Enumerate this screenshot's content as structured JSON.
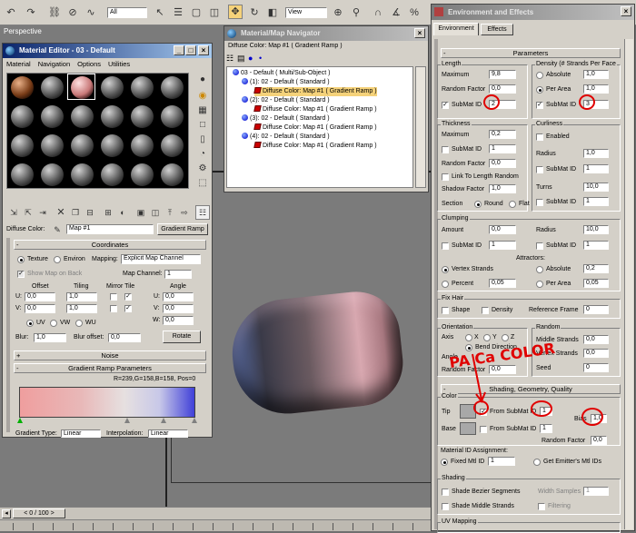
{
  "toolbar": {
    "selection_filter": "All",
    "view_dropdown": "View"
  },
  "viewport": {
    "label": "Perspective"
  },
  "material_editor": {
    "title": "Material Editor - 03 - Default",
    "menu": [
      "Material",
      "Navigation",
      "Options",
      "Utilities"
    ],
    "diffuse_color_label": "Diffuse Color:",
    "map_name": "Map #1",
    "map_type_button": "Gradient Ramp",
    "coordinates": {
      "title": "Coordinates",
      "texture_label": "Texture",
      "environ_label": "Environ",
      "mapping_label": "Mapping:",
      "mapping_value": "Explicit Map Channel",
      "show_map_on_back": "Show Map on Back",
      "map_channel_label": "Map Channel:",
      "map_channel_value": "1",
      "offset_header": "Offset",
      "tiling_header": "Tiling",
      "mirror_tile_header": "Mirror Tile",
      "angle_header": "Angle",
      "u_label": "U:",
      "v_label": "V:",
      "w_label": "W:",
      "u_offset": "0,0",
      "v_offset": "0,0",
      "u_tiling": "1,0",
      "v_tiling": "1,0",
      "u_angle": "0,0",
      "v_angle": "0,0",
      "w_angle": "0,0",
      "uv_label": "UV",
      "vw_label": "VW",
      "wu_label": "WU",
      "blur_label": "Blur:",
      "blur_value": "1,0",
      "blur_offset_label": "Blur offset:",
      "blur_offset_value": "0,0",
      "rotate_button": "Rotate"
    },
    "noise_title": "Noise",
    "gradient_ramp_title": "Gradient Ramp Parameters",
    "gradient_readout": "R=239,G=158,B=158, Pos=0",
    "gradient_type_label": "Gradient Type:",
    "gradient_type_value": "Linear",
    "interpolation_label": "Interpolation:",
    "interpolation_value": "Linear"
  },
  "navigator": {
    "title": "Material/Map Navigator",
    "header_text": "Diffuse Color: Map #1 ( Gradient Ramp )",
    "tree": [
      {
        "text": "03 - Default  ( Multi/Sub-Object )",
        "kind": "ball",
        "indent": 0,
        "selected": false
      },
      {
        "text": "(1): 02 - Default  ( Standard )",
        "kind": "ball",
        "indent": 1,
        "selected": false
      },
      {
        "text": "Diffuse Color: Map #1  ( Gradient Ramp )",
        "kind": "map",
        "indent": 2,
        "selected": true
      },
      {
        "text": "(2): 02 - Default  ( Standard )",
        "kind": "ball",
        "indent": 1,
        "selected": false
      },
      {
        "text": "Diffuse Color: Map #1  ( Gradient Ramp )",
        "kind": "map",
        "indent": 2,
        "selected": false
      },
      {
        "text": "(3): 02 - Default  ( Standard )",
        "kind": "ball",
        "indent": 1,
        "selected": false
      },
      {
        "text": "Diffuse Color: Map #1  ( Gradient Ramp )",
        "kind": "map",
        "indent": 2,
        "selected": false
      },
      {
        "text": "(4): 02 - Default  ( Standard )",
        "kind": "ball",
        "indent": 1,
        "selected": false
      },
      {
        "text": "Diffuse Color: Map #1  ( Gradient Ramp )",
        "kind": "map",
        "indent": 2,
        "selected": false
      }
    ]
  },
  "env": {
    "title": "Environment and Effects",
    "tabs": [
      "Environment",
      "Effects"
    ],
    "parameters_title": "Parameters",
    "length": {
      "title": "Length",
      "maximum_label": "Maximum",
      "maximum_value": "9,8",
      "random_factor_label": "Random Factor",
      "random_factor_value": "0,0",
      "submat_label": "SubMat ID",
      "submat_value": "2"
    },
    "density": {
      "title": "Density (# Strands Per Face",
      "absolute_label": "Absolute",
      "absolute_value": "1,0",
      "per_area_label": "Per Area",
      "per_area_value": "1,0",
      "submat_label": "SubMat ID",
      "submat_value": "3"
    },
    "thickness": {
      "title": "Thickness",
      "maximum_label": "Maximum",
      "maximum_value": "0,2",
      "submat_label": "SubMat ID",
      "submat_value": "1",
      "random_factor_label": "Random Factor",
      "random_factor_value": "0,0",
      "link_label": "Link To Length Random",
      "shadow_factor_label": "Shadow Factor",
      "shadow_factor_value": "1,0",
      "section_label": "Section",
      "round_label": "Round",
      "flat_label": "Flat"
    },
    "curliness": {
      "title": "Curliness",
      "enabled_label": "Enabled",
      "radius_label": "Radius",
      "radius_value": "1,0",
      "submat_label": "SubMat ID",
      "submat_value": "1",
      "turns_label": "Turns",
      "turns_value": "10,0",
      "submat2_label": "SubMat ID",
      "submat2_value": "1"
    },
    "clumping": {
      "title": "Clumping",
      "amount_label": "Amount",
      "amount_value": "0,0",
      "radius_label": "Radius",
      "radius_value": "10,0",
      "submat_label": "SubMat ID",
      "submat_value": "1",
      "submat2_label": "SubMat ID",
      "submat2_value": "1",
      "attractors_label": "Attractors:",
      "vertex_strands_label": "Vertex Strands",
      "absolute_label": "Absolute",
      "absolute_value": "0,2",
      "percent_label": "Percent",
      "percent_value": "0,05",
      "per_area_label": "Per Area",
      "per_area_value": "0,05"
    },
    "fix_hair": {
      "title": "Fix Hair",
      "shape_label": "Shape",
      "density_label": "Density",
      "ref_frame_label": "Reference Frame",
      "ref_frame_value": "0"
    },
    "orientation": {
      "title": "Orientation",
      "axis_label": "Axis",
      "x_label": "X",
      "y_label": "Y",
      "z_label": "Z",
      "bend_label": "Bend Direction",
      "angle_label": "Angle",
      "random_factor_label": "Random Factor",
      "random_factor_value": "0,0"
    },
    "random": {
      "title": "Random",
      "middle_strands_label": "Middle Strands",
      "middle_strands_value": "0,0",
      "vertex_strands_label": "Vertex Strands",
      "vertex_strands_value": "0,0",
      "seed_label": "Seed",
      "seed_value": "0"
    },
    "shading_title": "Shading, Geometry, Quality",
    "color": {
      "title": "Color",
      "tip_label": "Tip",
      "base_label": "Base",
      "from_submat_label": "From SubMat ID",
      "tip_value": "1",
      "base_value": "1",
      "bias_label": "Bias",
      "bias_value": "1,0",
      "random_factor_label": "Random Factor",
      "random_factor_value": "0,0"
    },
    "material_id": {
      "title": "Material ID Assignment:",
      "fixed_label": "Fixed Mtl ID",
      "fixed_value": "1",
      "emitter_label": "Get Emitter's Mtl IDs"
    },
    "shading": {
      "title": "Shading",
      "bezier_label": "Shade Bezier Segments",
      "width_samples_label": "Width Samples",
      "width_samples_value": "1",
      "middle_label": "Shade Middle Strands",
      "filtering_label": "Filtering"
    },
    "uv_mapping_title": "UV Mapping"
  },
  "annotation": {
    "handwritten": "PA  Ca  COLOR"
  },
  "timeline": {
    "frame_readout": "0 / 100"
  },
  "colors": {
    "title_active": "#0a246a",
    "gradient_left": "#ef9e9e",
    "gradient_right": "#4040d8",
    "annotation_red": "#e00000"
  }
}
